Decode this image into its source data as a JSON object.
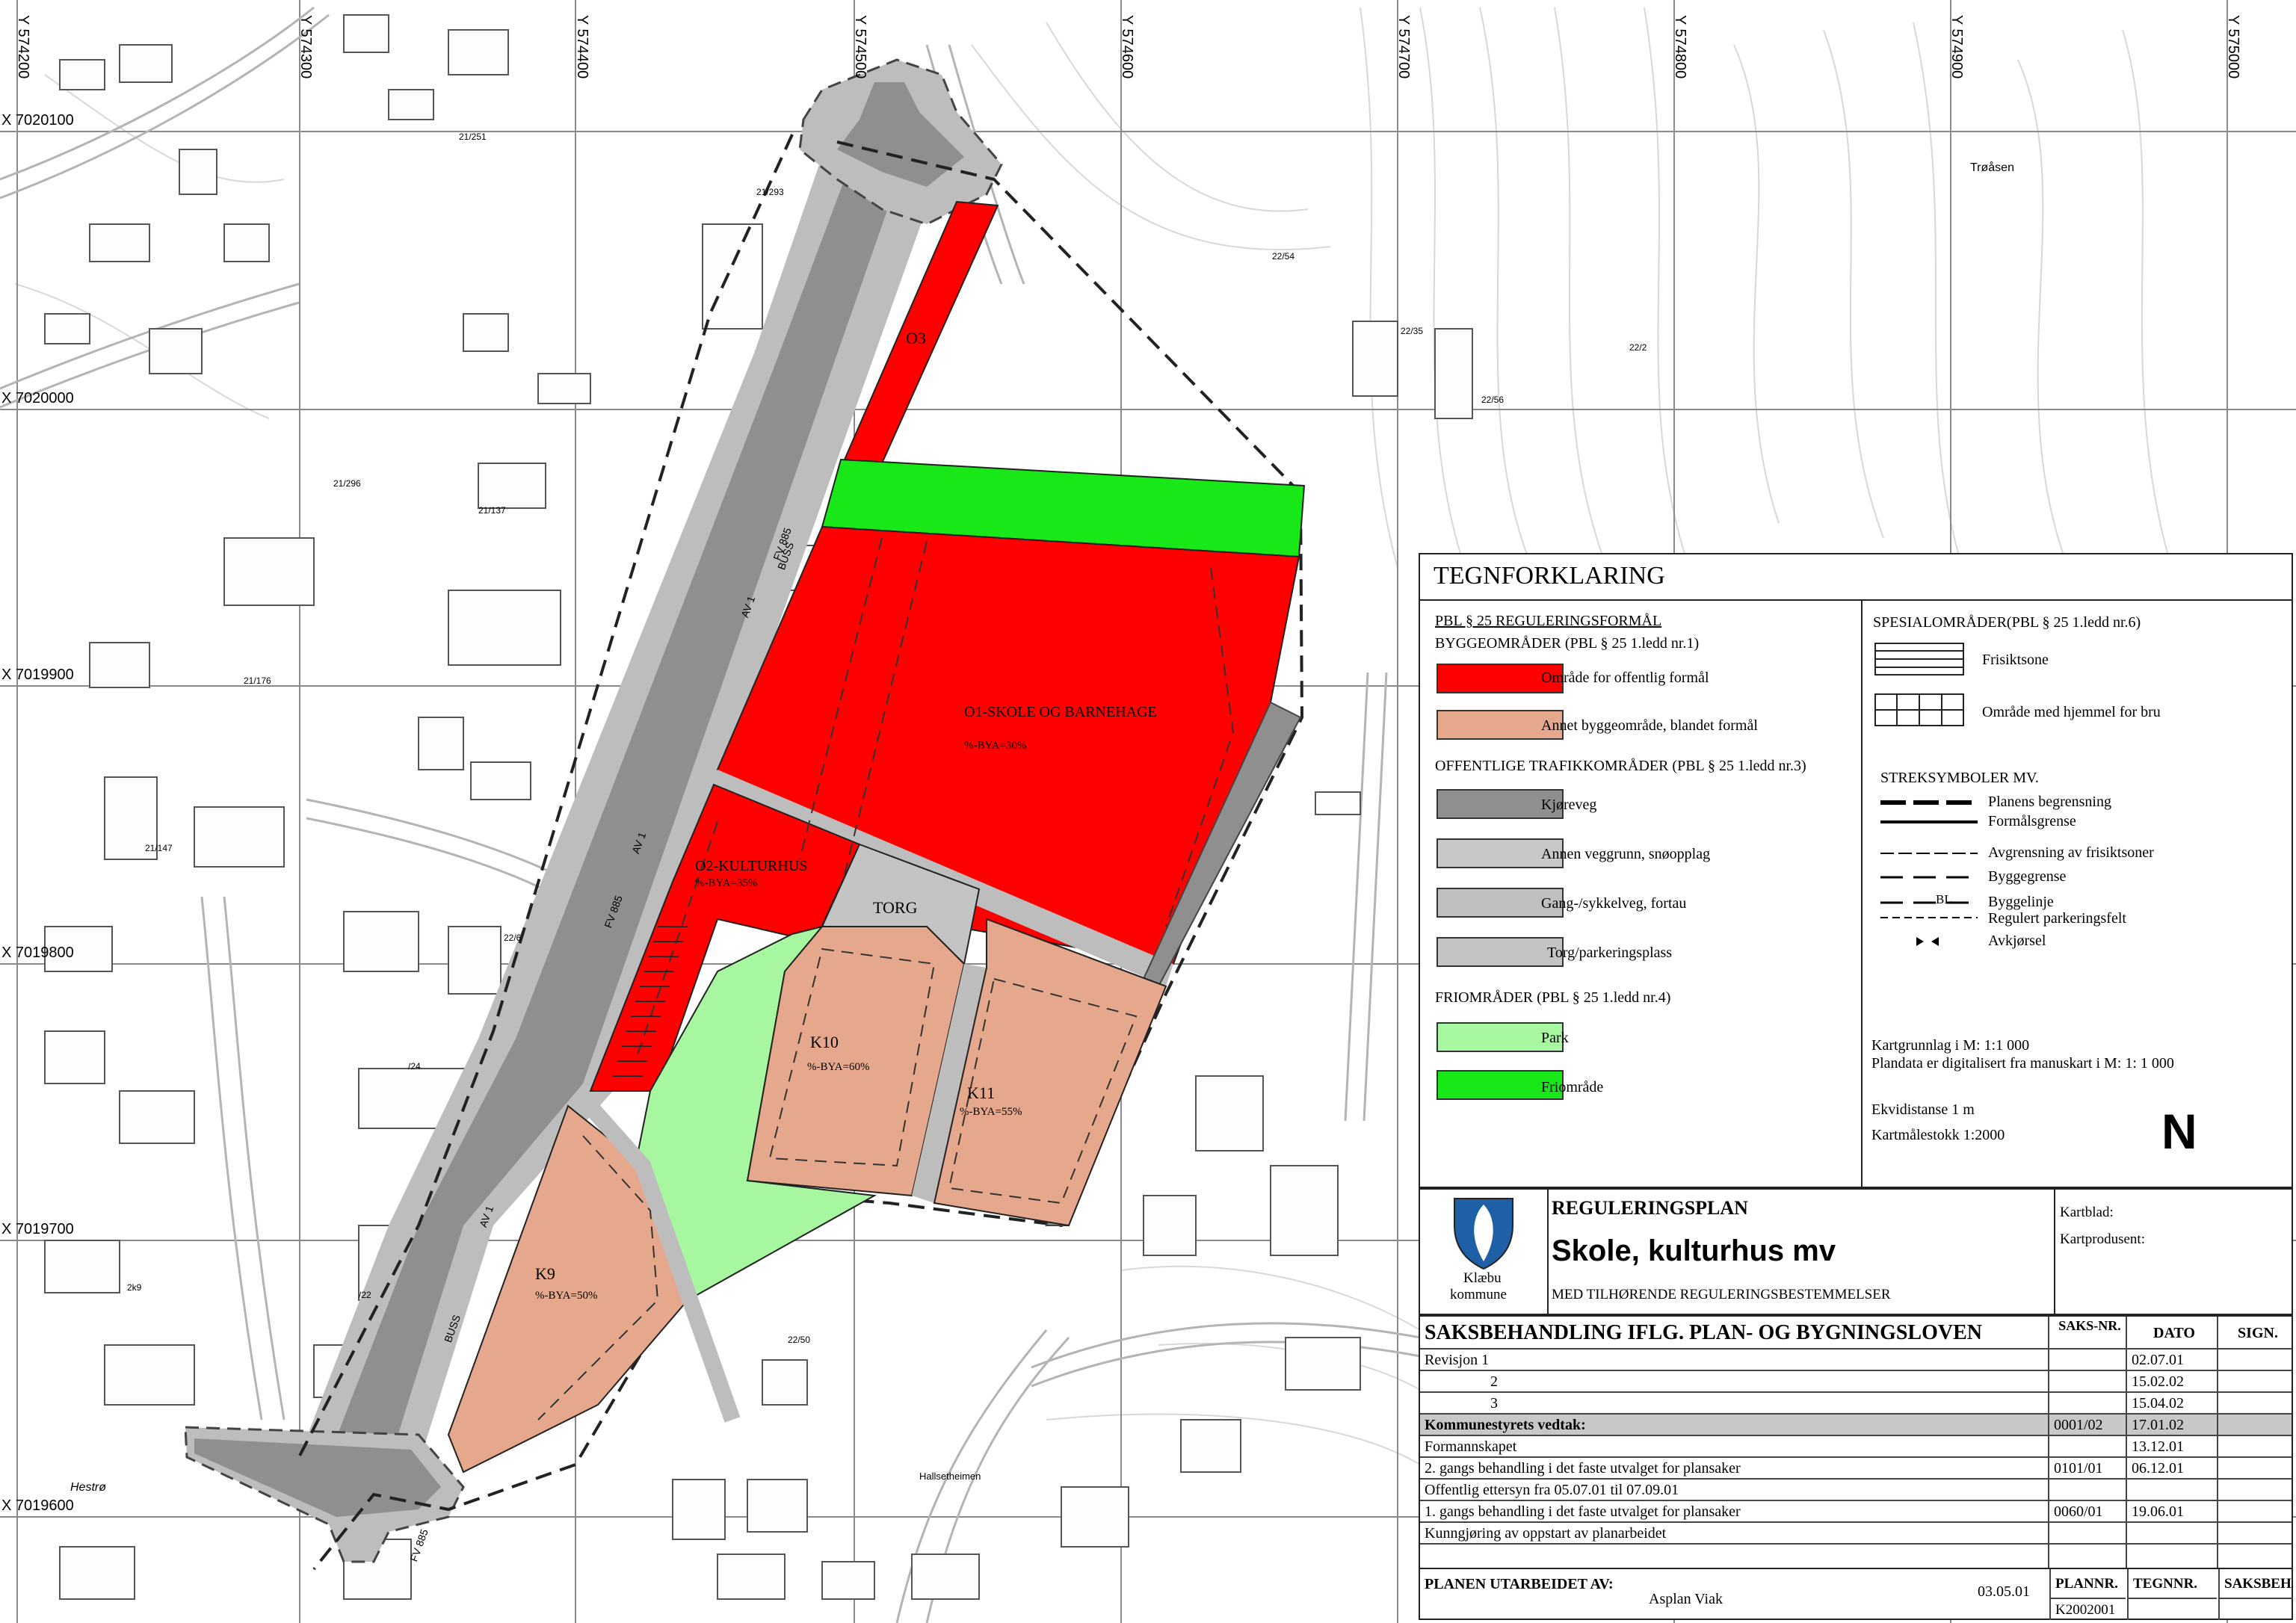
{
  "grid": {
    "y_labels": [
      "Y 574200",
      "Y 574300",
      "Y 574400",
      "Y 574500",
      "Y 574600",
      "Y 574700",
      "Y 574800",
      "Y 574900",
      "Y 575000"
    ],
    "x_labels": [
      "X 7020100",
      "X 7020000",
      "X 7019900",
      "X 7019800",
      "X 7019700",
      "X 7019600"
    ]
  },
  "zones": {
    "o1": "O1-SKOLE OG BARNEHAGE",
    "o1_bya": "%-BYA=30%",
    "o2": "O2-KULTURHUS",
    "o2_bya": "%-BYA=35%",
    "o3": "O3",
    "torg": "TORG",
    "k9": "K9",
    "k9_bya": "%-BYA=50%",
    "k10": "K10",
    "k10_bya": "%-BYA=60%",
    "k11": "K11",
    "k11_bya": "%-BYA=55%"
  },
  "places": {
    "troasen": "Trøåsen",
    "hestro": "Hestrø",
    "hallsetheimen": "Hallsetheimen",
    "fv885a": "FV 885",
    "fv885b": "FV 885",
    "fv885c": "FV 885",
    "av1": "AV 1",
    "av2": "AV 1",
    "av3": "AV 1",
    "buss1": "BUSS",
    "buss2": "BUSS",
    "parcel1": "22/54",
    "parcel2": "22/2",
    "parcel3": "22/56",
    "parcel4": "22/35",
    "parcel5": "21/137",
    "parcel6": "21/147",
    "parcel7": "22/6",
    "parcel8": "22/50",
    "parcel9": "21/251",
    "parcel10": "21/293",
    "parcel11": "21/296",
    "parcel12": "/24",
    "parcel13": "/22",
    "parcel14": "21/176",
    "parcel15": "2k9"
  },
  "legend": {
    "title": "TEGNFORKLARING",
    "pbl_header": "PBL § 25 REGULERINGSFORMÅL",
    "bygg_header": "BYGGEOMRÅDER (PBL § 25 1.ledd nr.1)",
    "offentlig": "Område for offentlig formål",
    "blandet": "Annet byggeområde, blandet formål",
    "trafikk_header": "OFFENTLIGE TRAFIKKOMRÅDER (PBL § 25 1.ledd nr.3)",
    "kjoreveg": "Kjøreveg",
    "veggrunn": "Annen veggrunn, snøopplag",
    "gang": "Gang-/sykkelveg, fortau",
    "torg": "Torg/parkeringsplass",
    "fri_header": "FRIOMRÅDER   (PBL § 25 1.ledd nr.4)",
    "park": "Park",
    "friomrade": "Friområde",
    "spesial_header": "SPESIALOMRÅDER(PBL § 25 1.ledd nr.6)",
    "frisikt": "Frisiktsone",
    "bru": "Område med hjemmel for bru",
    "streksymboler": "STREKSYMBOLER MV.",
    "planens": "Planens begrensning",
    "formal": "Formålsgrense",
    "avgrensning": "Avgrensning av frisiktsoner",
    "byggegrense": "Byggegrense",
    "byggelinje": "Byggelinje",
    "bl": "BL",
    "parkeringsfelt": "Regulert parkeringsfelt",
    "avkjorsel": "Avkjørsel",
    "kartgrunnlag": "Kartgrunnlag i M:  1:1 000",
    "plandata": "Plandata er digitalisert fra manuskart i M: 1: 1 000",
    "ekvidistanse": "Ekvidistanse  1 m",
    "kartmalestokk": "Kartmålestokk 1:2000",
    "north": "N",
    "colors": {
      "offentlig": "#ff0000",
      "blandet": "#e6a88c",
      "kjoreveg": "#8f8f8f",
      "veggrunn": "#c8c8c8",
      "gang": "#bfbfbf",
      "torg": "#c4c4c4",
      "park": "#a7f7a0",
      "friomrade": "#18e818"
    }
  },
  "title_block": {
    "kommune_line1": "Klæbu",
    "kommune_line2": "kommune",
    "type": "REGULERINGSPLAN",
    "name": "Skole, kulturhus mv",
    "subtitle": "MED TILHØRENDE REGULERINGSBESTEMMELSER",
    "kartblad": "Kartblad:",
    "kartprodusent": "Kartprodusent:"
  },
  "case_table": {
    "header": "SAKSBEHANDLING IFLG. PLAN- OG BYGNINGSLOVEN",
    "col_sak": "SAKS-NR.",
    "col_dato": "DATO",
    "col_sign": "SIGN.",
    "rows": [
      {
        "label": "Revisjon   1",
        "sak": "",
        "dato": "02.07.01"
      },
      {
        "label": "2",
        "sak": "",
        "dato": "15.02.02"
      },
      {
        "label": "3",
        "sak": "",
        "dato": "15.04.02"
      },
      {
        "label": "Kommunestyrets vedtak:",
        "sak": "0001/02",
        "dato": "17.01.02"
      },
      {
        "label": "Formannskapet",
        "sak": "",
        "dato": "13.12.01"
      },
      {
        "label": "2. gangs behandling i det faste utvalget for plansaker",
        "sak": "0101/01",
        "dato": "06.12.01"
      },
      {
        "label": "Offentlig ettersyn fra 05.07.01 til 07.09.01",
        "sak": "",
        "dato": ""
      },
      {
        "label": "1. gangs behandling i det faste utvalget for plansaker",
        "sak": "0060/01",
        "dato": "19.06.01"
      },
      {
        "label": "Kunngjøring av oppstart av planarbeidet",
        "sak": "",
        "dato": ""
      }
    ],
    "utarbeidet_label": "PLANEN UTARBEIDET AV:",
    "utarbeidet_by": "Asplan Viak",
    "utarbeidet_date": "03.05.01",
    "col_plannr": "PLANNR.",
    "col_tegnnr": "TEGNNR.",
    "col_saksbeh": "SAKSBEH.",
    "plannr": "K2002001"
  }
}
